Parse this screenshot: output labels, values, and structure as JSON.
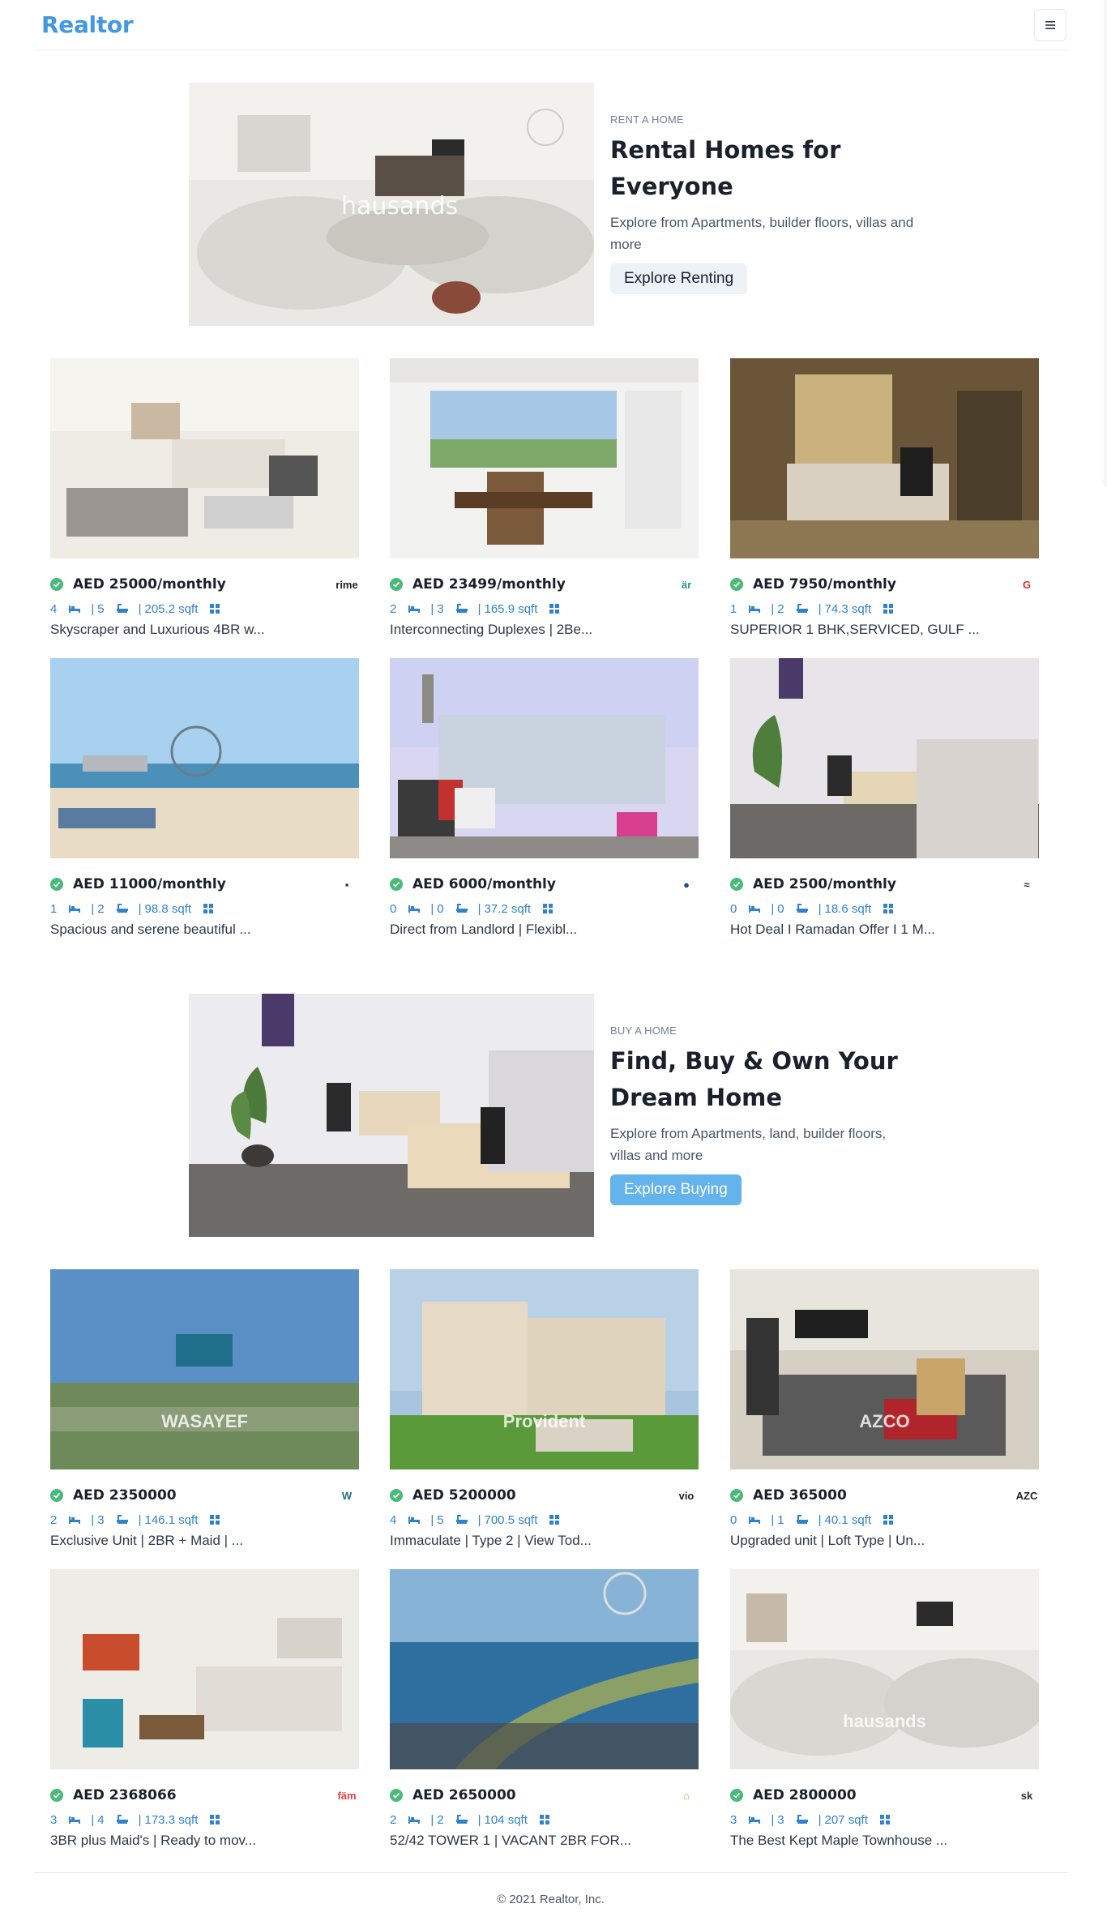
{
  "navbar": {
    "brand": "Realtor"
  },
  "rent_banner": {
    "purpose": "RENT A HOME",
    "title": "Rental Homes for Everyone",
    "desc": "Explore from Apartments, builder floors, villas and more",
    "button": "Explore Renting",
    "image_watermark": "hausands"
  },
  "buy_banner": {
    "purpose": "BUY A HOME",
    "title": "Find, Buy & Own Your Dream Home",
    "desc": "Explore from Apartments, land, builder floors, villas and more",
    "button": "Explore Buying"
  },
  "rent_props": [
    {
      "price": "AED 25000/monthly",
      "rooms": "4",
      "baths": "5",
      "area": "205.2 sqft",
      "title": "Skyscraper and Luxurious 4BR w...",
      "agency": "rime",
      "agency_color": "#222222"
    },
    {
      "price": "AED 23499/monthly",
      "rooms": "2",
      "baths": "3",
      "area": "165.9 sqft",
      "title": "Interconnecting Duplexes | 2Be...",
      "agency": "är",
      "agency_color": "#2c9a8e"
    },
    {
      "price": "AED 7950/monthly",
      "rooms": "1",
      "baths": "2",
      "area": "74.3 sqft",
      "title": "SUPERIOR 1 BHK,SERVICED, GULF ...",
      "agency": "G",
      "agency_color": "#d3332f"
    },
    {
      "price": "AED 11000/monthly",
      "rooms": "1",
      "baths": "2",
      "area": "98.8 sqft",
      "title": "Spacious and serene beautiful ...",
      "agency": "▪",
      "agency_color": "#333333"
    },
    {
      "price": "AED 6000/monthly",
      "rooms": "0",
      "baths": "0",
      "area": "37.2 sqft",
      "title": "Direct from Landlord | Flexibl...",
      "agency": "●",
      "agency_color": "#1f4f86"
    },
    {
      "price": "AED 2500/monthly",
      "rooms": "0",
      "baths": "0",
      "area": "18.6 sqft",
      "title": "Hot Deal I Ramadan Offer I 1 M...",
      "agency": "≈",
      "agency_color": "#333333"
    }
  ],
  "buy_props": [
    {
      "price": "AED 2350000",
      "rooms": "2",
      "baths": "3",
      "area": "146.1 sqft",
      "title": "Exclusive Unit | 2BR + Maid | ...",
      "agency": "W",
      "agency_color": "#1f6f8b",
      "img_overlay": "WASAYEF"
    },
    {
      "price": "AED 5200000",
      "rooms": "4",
      "baths": "5",
      "area": "700.5 sqft",
      "title": "Immaculate | Type 2 | View Tod...",
      "agency": "vio",
      "agency_color": "#222222",
      "img_overlay": "Provident"
    },
    {
      "price": "AED 365000",
      "rooms": "0",
      "baths": "1",
      "area": "40.1 sqft",
      "title": "Upgraded unit | Loft Type | Un...",
      "agency": "AZC",
      "agency_color": "#222222",
      "img_overlay": "AZCO"
    },
    {
      "price": "AED 2368066",
      "rooms": "3",
      "baths": "4",
      "area": "173.3 sqft",
      "title": "3BR plus Maid's | Ready to mov...",
      "agency": "fäm",
      "agency_color": "#e53e3e",
      "img_overlay": ""
    },
    {
      "price": "AED 2650000",
      "rooms": "2",
      "baths": "2",
      "area": "104 sqft",
      "title": "52/42 TOWER 1 | VACANT 2BR FOR...",
      "agency": "⌂",
      "agency_color": "#c69344",
      "img_overlay": ""
    },
    {
      "price": "AED 2800000",
      "rooms": "3",
      "baths": "3",
      "area": "207 sqft",
      "title": "The Best Kept Maple Townhouse ...",
      "agency": "sk",
      "agency_color": "#333333",
      "img_overlay": "hausands"
    }
  ],
  "footer": {
    "text": "© 2021 Realtor, Inc."
  }
}
